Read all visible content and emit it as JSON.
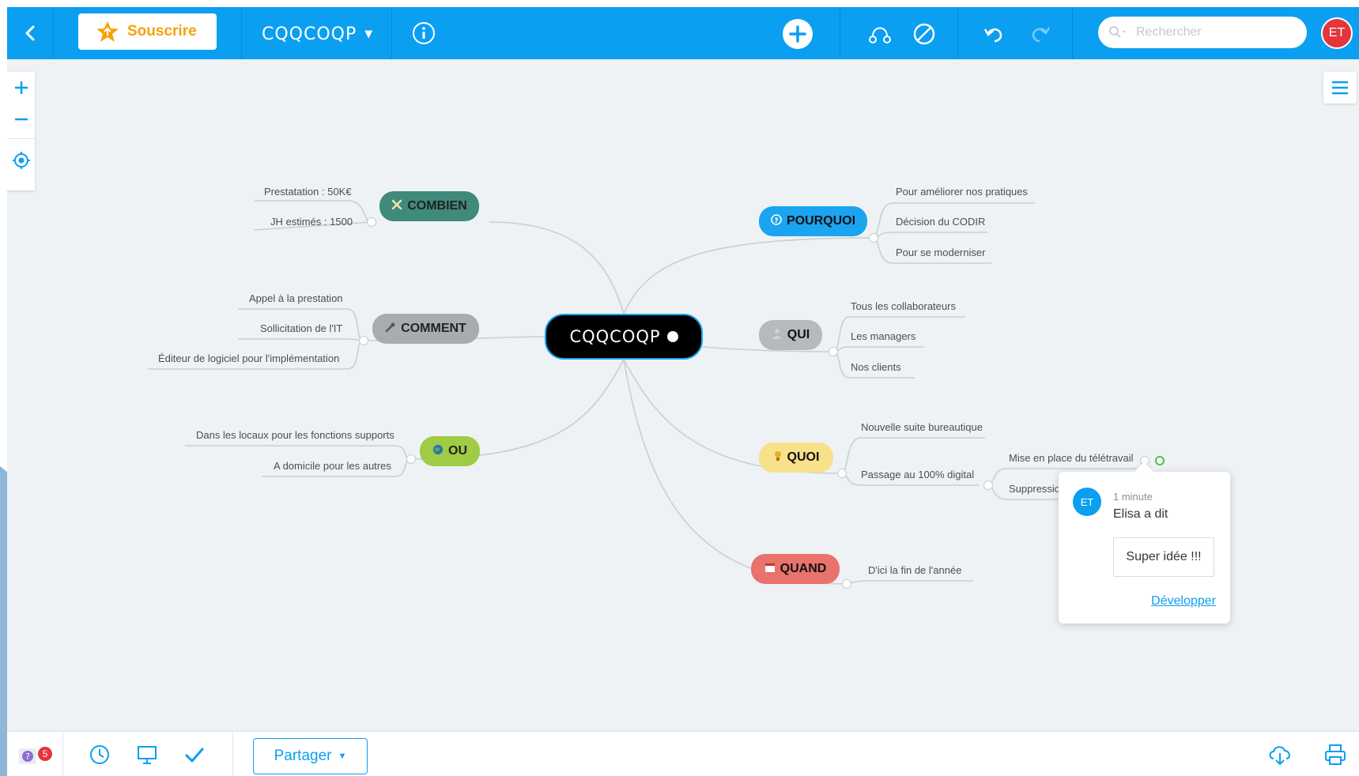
{
  "colors": {
    "accent": "#0b9ff1",
    "subscribe": "#f5a20a",
    "central_bg": "#000000",
    "combien": "#3f8a7a",
    "comment": "#a8acb0",
    "ou": "#9fcb45",
    "pourquoi": "#1ba4ef",
    "qui": "#b6babe",
    "quoi": "#f9e08a",
    "quand": "#e9726c",
    "avatar": "#e3353b"
  },
  "toolbar": {
    "back_icon": "chevron-left-icon",
    "subscribe_label": "Souscrire",
    "subscribe_icon": "star-icon",
    "map_title": "CQQCOQP",
    "info_icon": "info-icon",
    "add_icon": "plus-circle-icon",
    "link_icon": "relationship-icon",
    "cancel_icon": "forbidden-icon",
    "undo_icon": "undo-icon",
    "redo_icon": "redo-icon",
    "search_placeholder": "Rechercher",
    "user_initials": "ET"
  },
  "zoom": {
    "zoom_in": "+",
    "zoom_out": "−",
    "locate_icon": "target-icon"
  },
  "mindmap": {
    "central": "CQQCOQP",
    "branches": [
      {
        "key": "combien",
        "label": "COMBIEN",
        "icon": "tools-icon",
        "leaves": [
          "Prestatation : 50K€",
          "JH estimés : 1500"
        ]
      },
      {
        "key": "comment",
        "label": "COMMENT",
        "icon": "wrench-icon",
        "leaves": [
          "Appel à la prestation",
          "Sollicitation de l'IT",
          "Éditeur de logiciel pour l'implémentation"
        ]
      },
      {
        "key": "ou",
        "label": "OU",
        "icon": "globe-icon",
        "leaves": [
          "Dans les locaux pour les fonctions supports",
          "A domicile pour les autres"
        ]
      },
      {
        "key": "pourquoi",
        "label": "POURQUOI",
        "icon": "question-icon",
        "leaves": [
          "Pour améliorer nos pratiques",
          "Décision du CODIR",
          "Pour se moderniser"
        ]
      },
      {
        "key": "qui",
        "label": "QUI",
        "icon": "person-icon",
        "leaves": [
          "Tous les collaborateurs",
          "Les managers",
          "Nos clients"
        ]
      },
      {
        "key": "quoi",
        "label": "QUOI",
        "icon": "bulb-icon",
        "leaves": [
          "Nouvelle suite bureautique",
          "Passage au 100% digital"
        ],
        "subleaves": [
          "Mise en place du télétravail",
          "Suppressio"
        ]
      },
      {
        "key": "quand",
        "label": "QUAND",
        "icon": "calendar-icon",
        "leaves": [
          "D'ici la fin de l'année"
        ]
      }
    ]
  },
  "comment_popup": {
    "initials": "ET",
    "time": "1 minute",
    "author": "Elisa a dit",
    "text": "Super idée !!!",
    "link": "Développer"
  },
  "bottombar": {
    "help_badge": "5",
    "help_icon": "help-icon",
    "history_icon": "history-icon",
    "present_icon": "presentation-icon",
    "check_icon": "check-icon",
    "share_label": "Partager",
    "download_icon": "cloud-download-icon",
    "print_icon": "print-icon"
  }
}
